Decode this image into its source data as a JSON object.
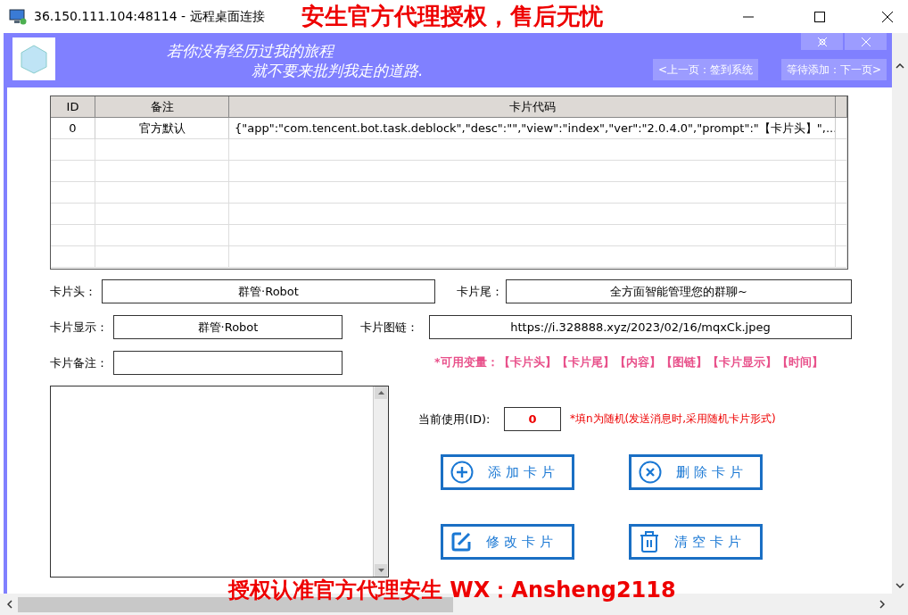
{
  "window": {
    "title": "36.150.111.104:48114 - 远程桌面连接"
  },
  "promo_top": "安生官方代理授权，售后无忧",
  "header": {
    "motto": [
      "若你没有经历过我的旅程",
      "就不要来批判我走的道路."
    ],
    "nav": [
      "<上一页：签到系统",
      "等待添加：下一页>"
    ]
  },
  "table": {
    "columns": [
      "ID",
      "备注",
      "卡片代码"
    ],
    "rows": [
      [
        "0",
        "官方默认",
        "{\"app\":\"com.tencent.bot.task.deblock\",\"desc\":\"\",\"view\":\"index\",\"ver\":\"2.0.4.0\",\"prompt\":\"【卡片头】\",..."
      ]
    ]
  },
  "fields": [
    {
      "label": "卡片头：",
      "value": "群管·Robot"
    },
    {
      "label": "卡片尾：",
      "value": "全方面智能管理您的群聊~"
    },
    {
      "label": "卡片显示：",
      "value": "群管·Robot"
    },
    {
      "label": "卡片图链：",
      "value": "https://i.328888.xyz/2023/02/16/mqxCk.jpeg"
    },
    {
      "label": "卡片备注："
    }
  ],
  "variables_hint": "*可用变量：【卡片头】【卡片尾】【内容】【图链】【卡片显示】【时间】",
  "current_id": {
    "label": "当前使用(ID):",
    "value": "0",
    "hint": "*填n为随机(发送消息时,采用随机卡片形式)"
  },
  "buttons": [
    {
      "label": "添加卡片",
      "kind": "add"
    },
    {
      "label": "删除卡片",
      "kind": "delete"
    },
    {
      "label": "修改卡片",
      "kind": "edit"
    },
    {
      "label": "清空卡片",
      "kind": "clear"
    }
  ],
  "promo_bottom": "授权认准官方代理安生  WX：Ansheng2118"
}
